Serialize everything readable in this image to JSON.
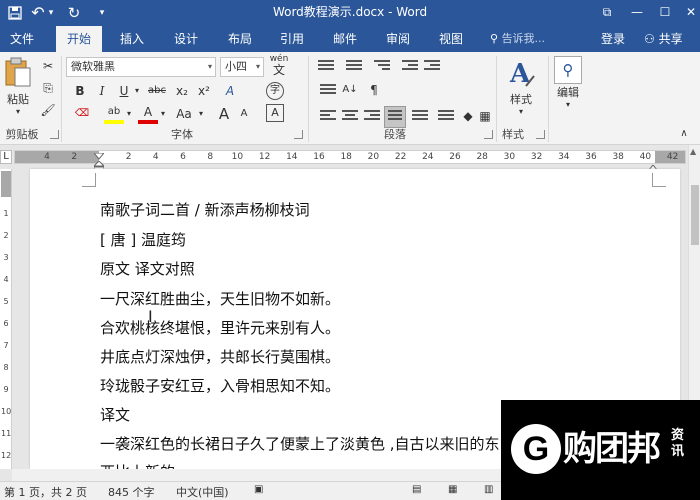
{
  "titlebar": {
    "title": "Word教程演示.docx - Word",
    "save_icon": "save-icon",
    "undo_glyph": "↶",
    "undo_arrow": "▾",
    "redo_glyph": "↻",
    "customize_glyph": "▾",
    "restore_glyph": "⧉",
    "min_glyph": "—",
    "max_glyph": "☐",
    "close_glyph": "✕"
  },
  "tabs": [
    "文件",
    "开始",
    "插入",
    "设计",
    "布局",
    "引用",
    "邮件",
    "审阅",
    "视图"
  ],
  "tell_me": "告诉我...",
  "login": "登录",
  "share": "共享",
  "clipboard": {
    "paste": "粘贴",
    "label": "剪贴板"
  },
  "font": {
    "name": "微软雅黑",
    "size": "小四",
    "wen": "wén",
    "wen_char": "文",
    "bold": "B",
    "italic": "I",
    "underline": "U",
    "strike": "abc",
    "sub": "x₂",
    "sup": "x²",
    "clear": "A",
    "highlight": "ab",
    "color": "A",
    "case": "Aa",
    "grow": "A",
    "shrink": "A",
    "circle": "字",
    "aa_size": "A",
    "label": "字体"
  },
  "paragraph": {
    "label": "段落",
    "sort": "A↓",
    "mark": "¶"
  },
  "styles": {
    "button": "样式",
    "label": "样式"
  },
  "editing": {
    "button": "编辑"
  },
  "ruler": {
    "ticks": [
      "4",
      "2",
      "",
      "2",
      "4",
      "6",
      "8",
      "10",
      "12",
      "14",
      "16",
      "18",
      "20",
      "22",
      "24",
      "26",
      "28",
      "30",
      "32",
      "34",
      "36",
      "38",
      "40",
      "42"
    ]
  },
  "vruler": [
    "1",
    "2",
    "3",
    "4",
    "5",
    "6",
    "7",
    "8",
    "9",
    "10",
    "11",
    "12"
  ],
  "document": {
    "lines": [
      "南歌子词二首 / 新添声杨柳枝词",
      "[ 唐 ] 温庭筠",
      "原文  译文对照",
      "一尺深红胜曲尘，天生旧物不如新。",
      "合欢桃核终堪恨，里许元来别有人。",
      "井底点灯深烛伊，共郎长行莫围棋。",
      "玲珑骰子安红豆，入骨相思知不知。",
      "译文",
      "一袭深红色的长裙日子久了便蒙上了淡黄色 ,自古以来旧的东",
      "西比上新的"
    ]
  },
  "status": {
    "page": "第 1 页，共 2 页",
    "words": "845 个字",
    "lang": "中文(中国)"
  },
  "watermark": {
    "g": "G",
    "text": "购团邦",
    "sub1": "资",
    "sub2": "讯"
  },
  "colors": {
    "accent": "#2b579a",
    "ribbon": "#f3f3f3",
    "highlight": "#ffff00",
    "fontcolor": "#e00000"
  }
}
